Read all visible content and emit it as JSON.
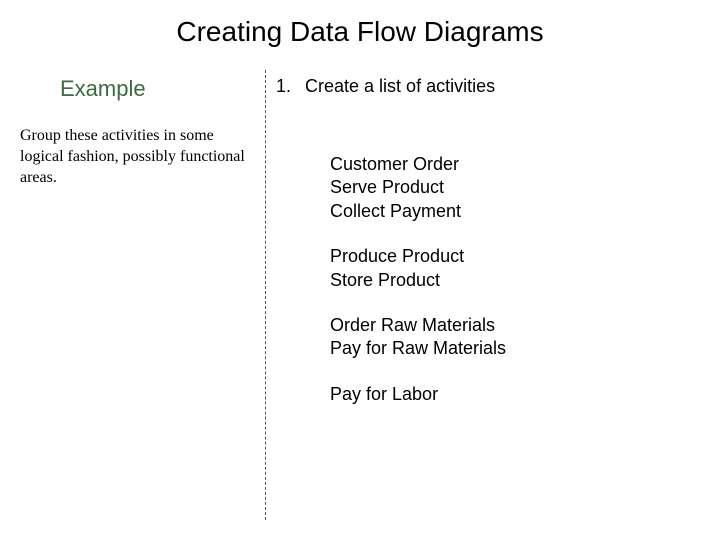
{
  "title": "Creating Data Flow Diagrams",
  "subtitle": "Example",
  "note": "Group these activities in some logical fashion, possibly functional areas.",
  "step_num": "1.",
  "step_text": "Create a list of activities",
  "groups": {
    "g0": {
      "i0": "Customer Order",
      "i1": "Serve Product",
      "i2": "Collect Payment"
    },
    "g1": {
      "i0": "Produce Product",
      "i1": "Store Product"
    },
    "g2": {
      "i0": "Order Raw Materials",
      "i1": "Pay for Raw Materials"
    },
    "g3": {
      "i0": "Pay for Labor"
    }
  }
}
